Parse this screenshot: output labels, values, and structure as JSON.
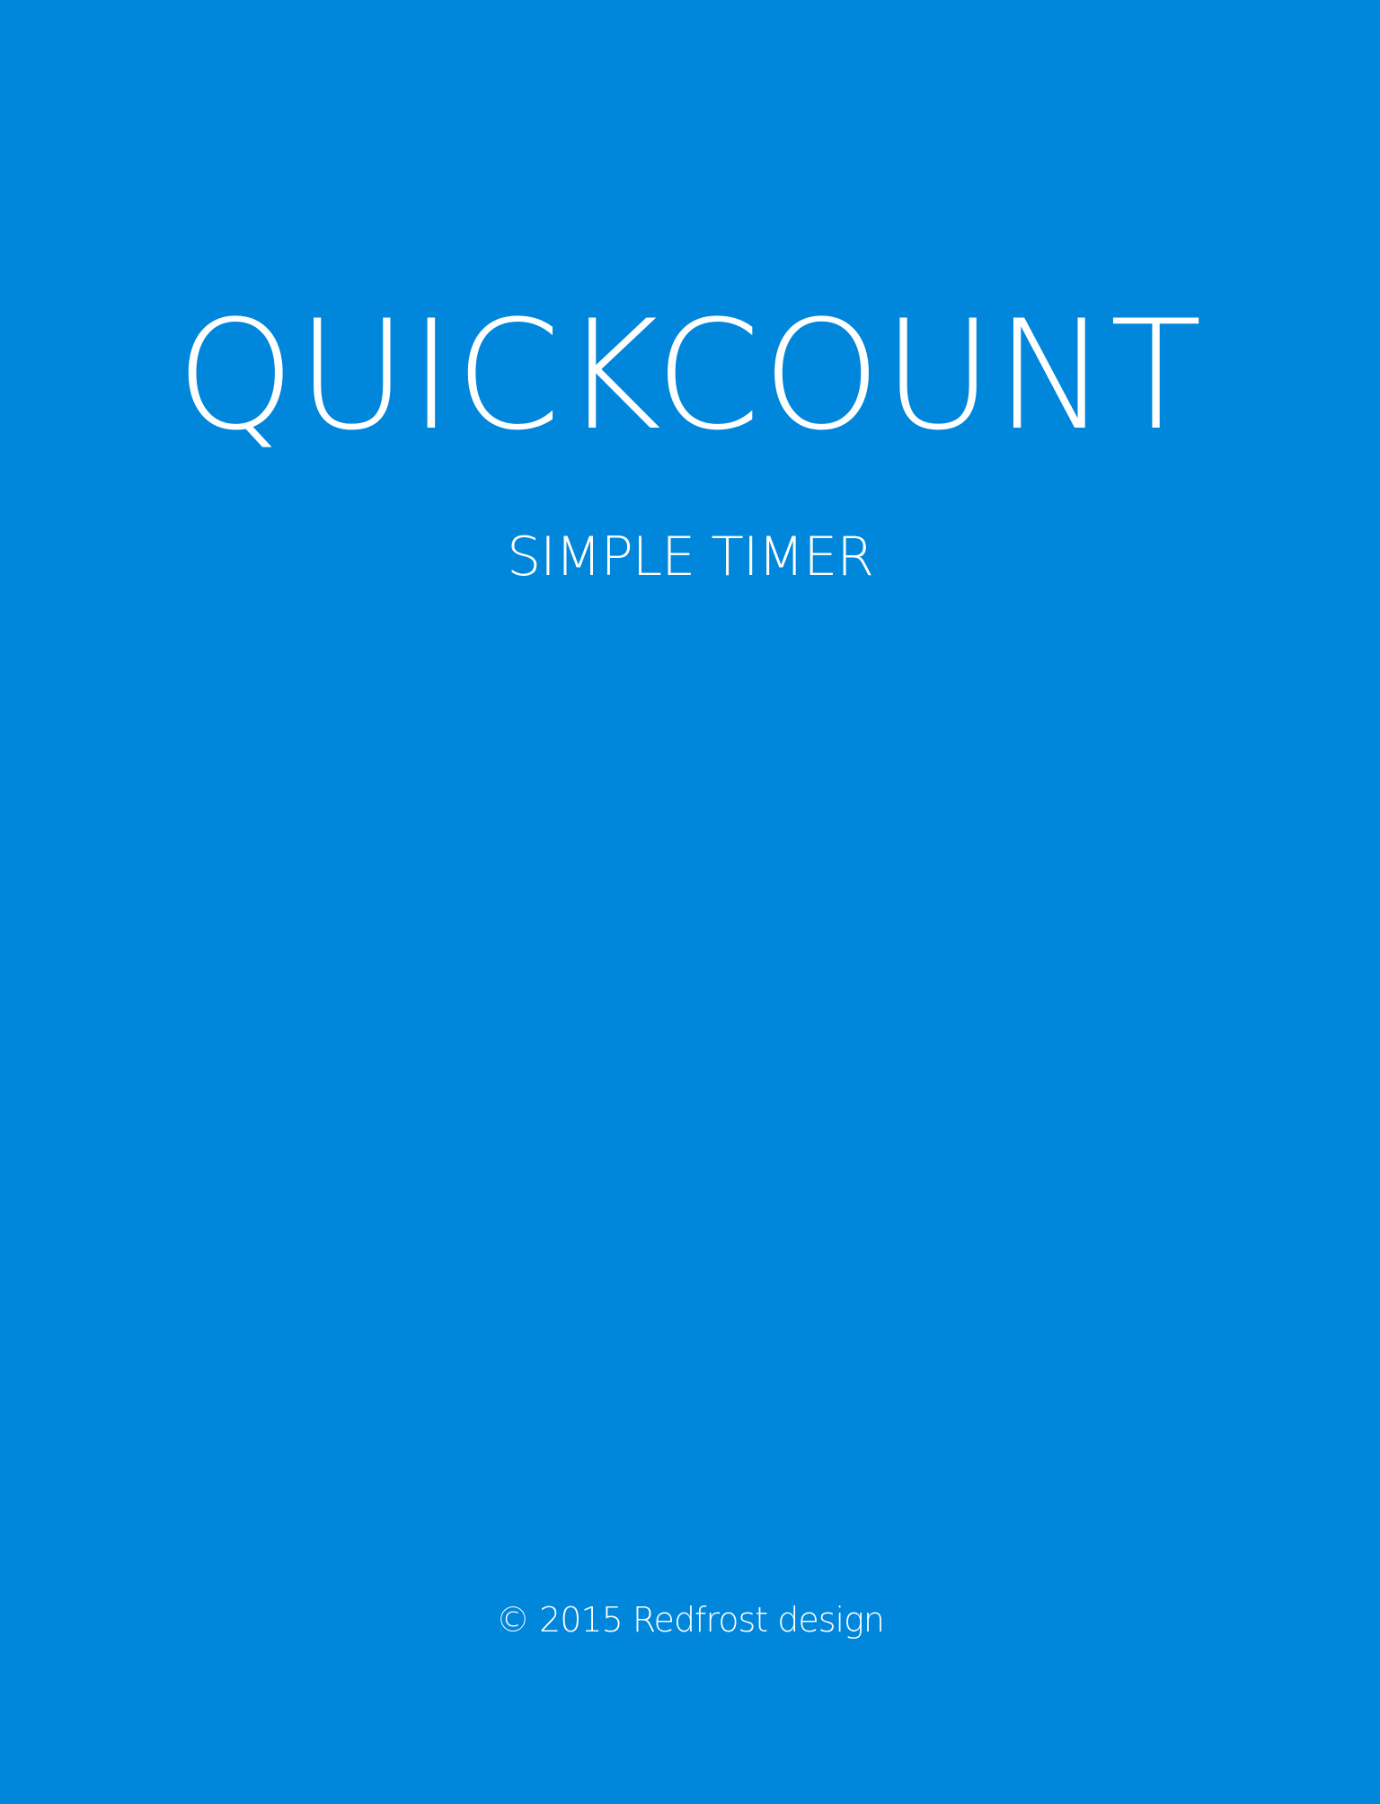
{
  "colors": {
    "background": "#0086db",
    "text": "#ffffff"
  },
  "splash": {
    "title": "QUICKCOUNT",
    "subtitle": "SIMPLE TIMER",
    "copyright": "© 2015 Redfrost design"
  }
}
